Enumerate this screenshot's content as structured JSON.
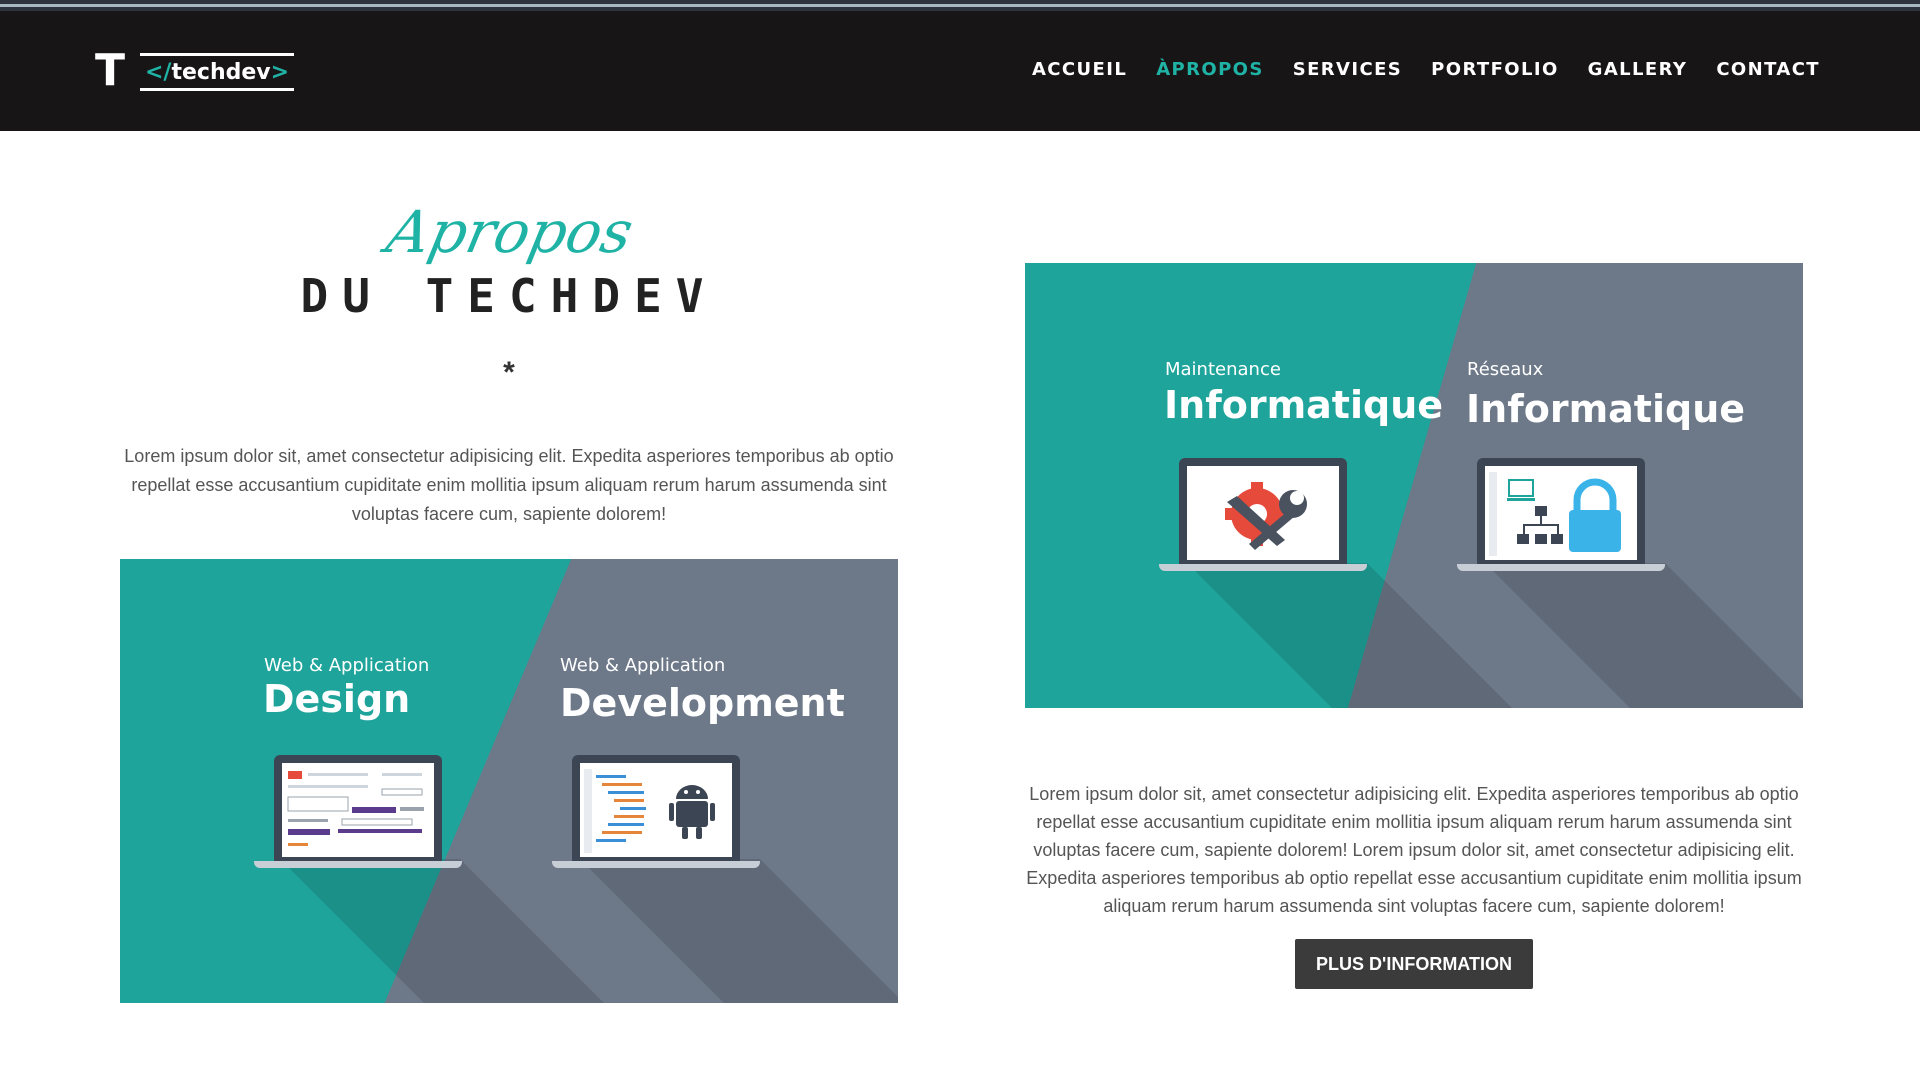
{
  "header": {
    "logo_letter": "T",
    "logo_open": "</",
    "logo_name": "techdev",
    "logo_close": ">",
    "nav": [
      "ACCUEIL",
      "ÀPROPOS",
      "SERVICES",
      "PORTFOLIO",
      "GALLERY",
      "CONTACT"
    ],
    "active_nav": "ÀPROPOS"
  },
  "about": {
    "script_title": "Apropos",
    "main_title": "DU TECHDEV",
    "divider": "*",
    "intro": "Lorem ipsum dolor sit, amet consectetur adipisicing elit. Expedita asperiores temporibus ab optio repellat esse accusantium cupiditate enim mollitia ipsum aliquam rerum harum assumenda sint voluptas facere cum, sapiente dolorem!"
  },
  "banner_left": {
    "panel1_small": "Web & Application",
    "panel1_big": "Design",
    "panel1_icon": "web-design-screen-icon",
    "panel2_small": "Web & Application",
    "panel2_big": "Development",
    "panel2_icon": "android-code-screen-icon"
  },
  "banner_right": {
    "panel1_small": "Maintenance",
    "panel1_big": "Informatique",
    "panel1_icon": "gear-wrench-icon",
    "panel2_small": "Réseaux",
    "panel2_big": "Informatique",
    "panel2_icon": "network-lock-icon"
  },
  "details": {
    "text": "Lorem ipsum dolor sit, amet consectetur adipisicing elit. Expedita asperiores temporibus ab optio repellat esse accusantium cupiditate enim mollitia ipsum aliquam rerum harum assumenda sint voluptas facere cum, sapiente dolorem! Lorem ipsum dolor sit, amet consectetur adipisicing elit. Expedita asperiores temporibus ab optio repellat esse accusantium cupiditate enim mollitia ipsum aliquam rerum harum assumenda sint voluptas facere cum, sapiente dolorem!",
    "button": "PLUS D'INFORMATION"
  },
  "colors": {
    "accent": "#1fb3a6",
    "banner_teal": "#1fa49b",
    "banner_slate": "#6d7889",
    "navbar": "#181516",
    "button": "#3b3b3b"
  }
}
